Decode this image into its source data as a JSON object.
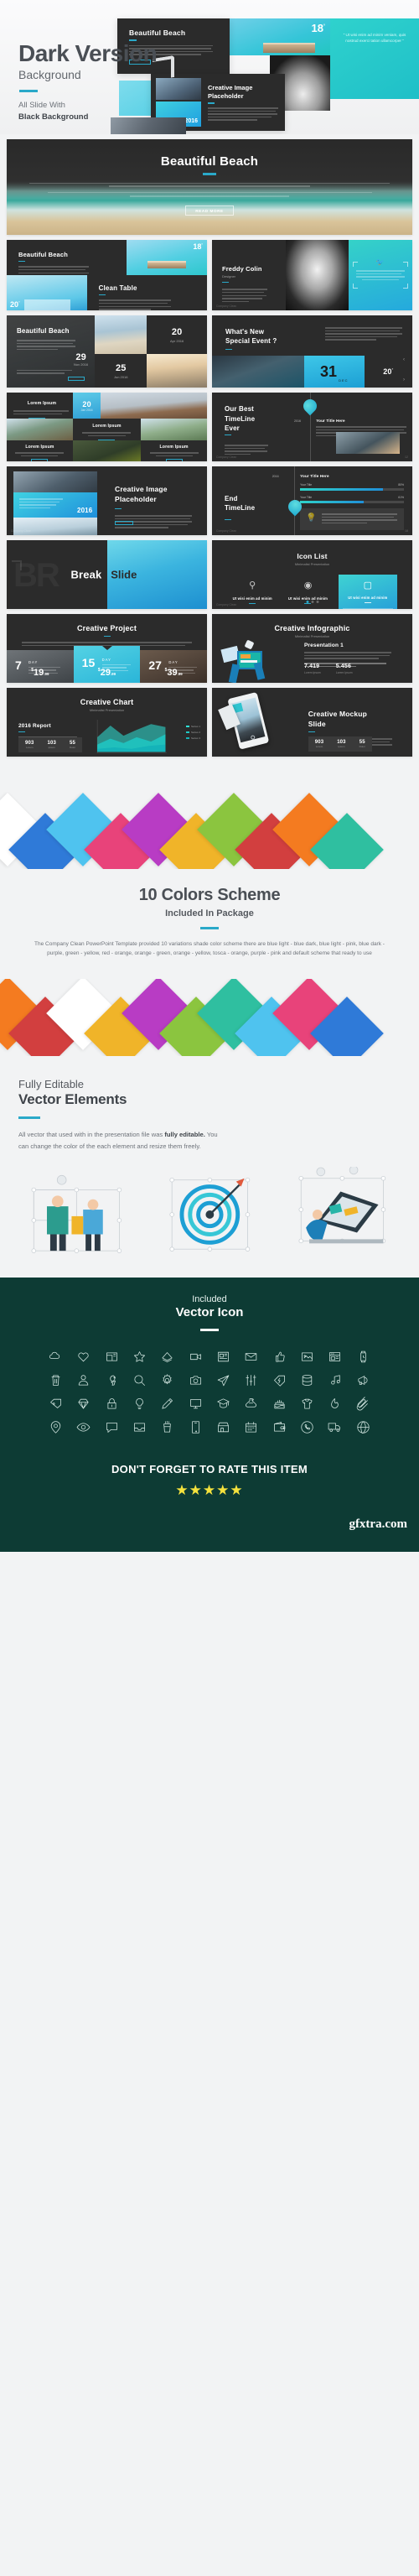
{
  "hero": {
    "title": "Dark Version",
    "subtitle": "Background",
    "tagline_line1": "All Slide With",
    "tagline_line2": "Black Background",
    "slides": {
      "beautiful_beach": "Beautiful Beach",
      "creative_image_placeholder_line1": "Creative Image",
      "creative_image_placeholder_line2": "Placeholder",
      "year_badge": "2016",
      "temp_badge": "18",
      "temp_unit": "°"
    }
  },
  "preview": {
    "hero_slide": {
      "title": "Beautiful Beach",
      "button": "READ MORE"
    },
    "slides": [
      {
        "name": "beautiful-beach-grid",
        "title": "Beautiful Beach",
        "badge": "18",
        "badge_unit": "°",
        "secondary_title": "Clean Table",
        "corner_badge": "20",
        "corner_unit": "°"
      },
      {
        "name": "profile-quote",
        "title": "Freddy Colin",
        "subtitle": "Designer"
      },
      {
        "name": "beach-dates",
        "title": "Beautiful Beach",
        "dates": [
          {
            "day": "20",
            "label": "Apr 2016"
          },
          {
            "day": "29",
            "label": "Nov 2016"
          },
          {
            "day": "25",
            "label": "Jun 2016"
          }
        ]
      },
      {
        "name": "special-event",
        "title_line1": "What's New",
        "title_line2": "Special Event ?",
        "big_number": "31",
        "month": "DEC",
        "temp": "20",
        "temp_unit": "°"
      },
      {
        "name": "lorem-grid",
        "caption": "Lorem Ipsum",
        "date_day": "20",
        "date_label": "Jan 2016",
        "item_titles": [
          "Lorem Ipsum",
          "Lorem Ipsum",
          "Lorem Ipsum",
          "Lorem Ipsum"
        ]
      },
      {
        "name": "timeline-start",
        "title_line1": "Our Best",
        "title_line2": "TimeLine",
        "title_line3": "Ever",
        "year": "2016",
        "item_title": "Your Title Here"
      },
      {
        "name": "creative-image-placeholder",
        "title_line1": "Creative Image",
        "title_line2": "Placeholder",
        "year": "2016"
      },
      {
        "name": "timeline-end",
        "title_line1": "End",
        "title_line2": "TimeLine",
        "year": "2016",
        "item_title": "Your Title Here",
        "bars": [
          {
            "label": "Your Title",
            "value": "80%"
          },
          {
            "label": "Your Title",
            "value": "61%"
          }
        ]
      },
      {
        "name": "break-slide",
        "word1": "Break",
        "word2": "Slide",
        "ghost": "BR"
      },
      {
        "name": "icon-list",
        "title": "Icon List",
        "subtitle": "Minimalist Presentation",
        "items": [
          "Ut wisi enim ad minim",
          "Ut wisi enim ad minim",
          "Ut wisi enim ad minim"
        ]
      },
      {
        "name": "creative-project",
        "title": "Creative Project",
        "plans": [
          {
            "days": "7",
            "unit": "DAY",
            "price": "19",
            "cents": ".99"
          },
          {
            "days": "15",
            "unit": "DAY",
            "price": "29",
            "cents": ".99"
          },
          {
            "days": "27",
            "unit": "DAY",
            "price": "39",
            "cents": ".99"
          }
        ]
      },
      {
        "name": "creative-infographic",
        "title": "Creative Infographic",
        "subtitle": "Minimalist Presentation",
        "heading": "Presentation 1",
        "stat1": "7.419",
        "stat2": "5.456",
        "stat1_label": "Lorem Ipsum",
        "stat2_label": "Lorem Ipsum"
      },
      {
        "name": "creative-chart",
        "title": "Creative Chart",
        "subtitle": "Minimalist Presentation",
        "heading": "2016 Report",
        "stats": [
          {
            "value": "903",
            "label": "Lorem"
          },
          {
            "value": "103",
            "label": "Ipsum"
          },
          {
            "value": "55",
            "label": "Dolor"
          }
        ]
      },
      {
        "name": "creative-mockup",
        "title_line1": "Creative Mockup",
        "title_line2": "Slide",
        "stats": [
          {
            "value": "903",
            "label": "Lorem"
          },
          {
            "value": "103",
            "label": "Ipsum"
          },
          {
            "value": "55",
            "label": "Dolor"
          }
        ]
      }
    ]
  },
  "colors_section": {
    "title": "10 Colors Scheme",
    "subtitle": "Included In Package",
    "description": "The Company Clean PowerPoint Template provided 10 variations shade color scheme there are blue light - blue dark, blue light - pink, blue dark - purple, green - yellow, red - orange, orange - green, orange - yellow, tosca - orange, purple - pink and default scheme that ready to use",
    "swatches_top": [
      "#ffffff",
      "#2f7ad8",
      "#4fc3ef",
      "#e8437a",
      "#b83cc4",
      "#f0b429",
      "#8bc53f",
      "#d23f3f",
      "#f47b20",
      "#2fbfa0"
    ],
    "swatches_bottom": [
      "#f47b20",
      "#d23f3f",
      "#ffffff",
      "#f0b429",
      "#b83cc4",
      "#8bc53f",
      "#2fbfa0",
      "#4fc3ef",
      "#e8437a",
      "#2f7ad8"
    ]
  },
  "vector_section": {
    "eyebrow": "Fully Editable",
    "title": "Vector Elements",
    "paragraph_part1": "All vector that used with in the presentation file was ",
    "paragraph_bold": "fully editable.",
    "paragraph_part2": " You can change the color of the each element and resize them freely."
  },
  "icons_section": {
    "eyebrow": "Included",
    "title": "Vector Icon",
    "icons": [
      "cloud-icon",
      "heart-icon",
      "tv-icon",
      "star-icon",
      "layers-icon",
      "video-camera-icon",
      "newspaper-icon",
      "envelope-icon",
      "thumbs-up-icon",
      "image-icon",
      "browser-icon",
      "watch-icon",
      "trash-icon",
      "user-icon",
      "key-icon",
      "search-icon",
      "gear-icon",
      "camera-icon",
      "paper-plane-icon",
      "sliders-icon",
      "flash-tag-icon",
      "database-icon",
      "music-icon",
      "megaphone-icon",
      "tag-icon",
      "diamond-icon",
      "lock-icon",
      "lightbulb-icon",
      "pencil-icon",
      "monitor-icon",
      "graduation-cap-icon",
      "flask-icon",
      "cake-icon",
      "tshirt-icon",
      "fire-icon",
      "paperclip-icon",
      "map-pin-icon",
      "eye-icon",
      "chat-bubble-icon",
      "inbox-icon",
      "coffee-cup-icon",
      "smartphone-icon",
      "store-icon",
      "calendar-icon",
      "wallet-icon",
      "phone-circle-icon",
      "truck-icon",
      "globe-icon"
    ]
  },
  "footer": {
    "rate_text": "DON'T FORGET TO RATE THIS ITEM",
    "stars": "★★★★★",
    "watermark": "gfxtra.com"
  },
  "theme": {
    "accent": "#2aa9c9",
    "dark_slide": "#2b2b2b",
    "page_bg": "#f2f3f4",
    "icons_bg": "#0d3b34",
    "star_color": "#f5e23d"
  }
}
